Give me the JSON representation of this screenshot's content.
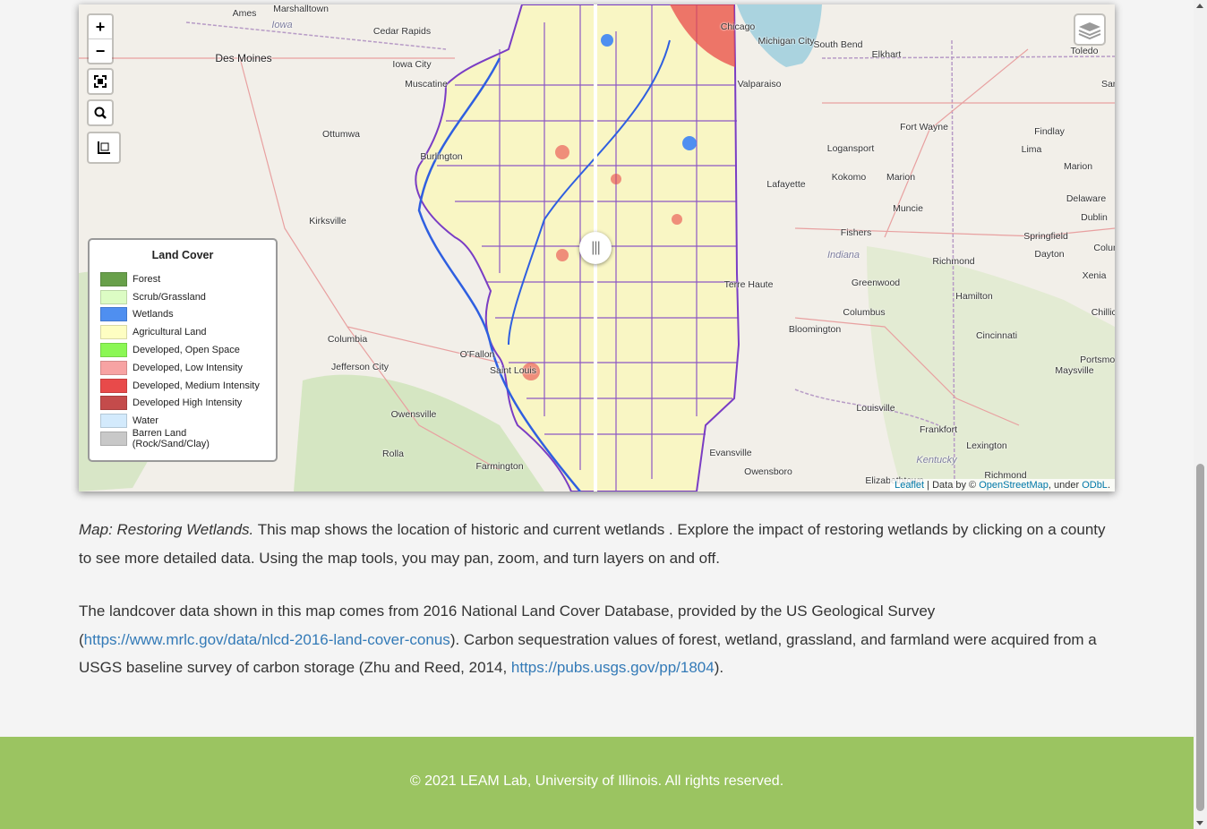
{
  "map": {
    "zoom_in_label": "+",
    "zoom_out_label": "−",
    "places": [
      "Ames",
      "Marshalltown",
      "Iowa",
      "Cedar Rapids",
      "Des Moines",
      "Iowa City",
      "Muscatine",
      "Ottumwa",
      "Kirksville",
      "Burlington",
      "Columbia",
      "Jefferson City",
      "Owensville",
      "Rolla",
      "Farmington",
      "O'Fallon",
      "Saint Louis",
      "Chicago",
      "Michigan City",
      "South Bend",
      "Elkhart",
      "Toledo",
      "Valparaiso",
      "Fort Wayne",
      "Findlay",
      "Lima",
      "Marion",
      "Logansport",
      "Kokomo",
      "Lafayette",
      "Marion",
      "Muncie",
      "Indiana",
      "Fishers",
      "Richmond",
      "Dayton",
      "Springfield",
      "Columbus",
      "Greenwood",
      "Terre Haute",
      "Bloomington",
      "Columbus",
      "Hamilton",
      "Cincinnati",
      "Chillicothe",
      "Xenia",
      "Dublin",
      "Delaware",
      "Louisville",
      "Frankfort",
      "Lexington",
      "Maysville",
      "Portsmouth",
      "Kentucky",
      "Evansville",
      "Owensboro",
      "Richmond",
      "Elizabethtown",
      "Sandusky"
    ],
    "legend": {
      "title": "Land Cover",
      "items": [
        {
          "label": "Forest",
          "color": "#68a04a"
        },
        {
          "label": "Scrub/Grassland",
          "color": "#dcfcc4"
        },
        {
          "label": "Wetlands",
          "color": "#4f8ff0"
        },
        {
          "label": "Agricultural Land",
          "color": "#fefec2"
        },
        {
          "label": "Developed, Open Space",
          "color": "#8bf754"
        },
        {
          "label": "Developed, Low Intensity",
          "color": "#f7a3a3"
        },
        {
          "label": "Developed, Medium Intensity",
          "color": "#e84a4a"
        },
        {
          "label": "Developed High Intensity",
          "color": "#c44b4b"
        },
        {
          "label": "Water",
          "color": "#d3eafc"
        },
        {
          "label": "Barren Land (Rock/Sand/Clay)",
          "color": "#c8c8c8"
        }
      ]
    },
    "attribution": {
      "leaflet": "Leaflet",
      "sep": " | Data by © ",
      "osm": "OpenStreetMap",
      "under": ", under ",
      "odbl": "ODbL",
      "end": "."
    }
  },
  "caption": {
    "title": "Map: Restoring Wetlands.",
    "text": " This map shows the location of historic and current wetlands . Explore the impact of restoring wetlands by clicking on a county to see more detailed data. Using the map tools, you may pan, zoom, and turn layers on and off."
  },
  "source": {
    "text1": "The landcover data shown in this map comes from 2016 National Land Cover Database, provided by the US Geological Survey (",
    "link1": "https://www.mrlc.gov/data/nlcd-2016-land-cover-conus",
    "text2": "). Carbon sequestration values of forest, wetland, grassland, and farmland were acquired from a USGS baseline survey of carbon storage (Zhu and Reed, 2014, ",
    "link2": "https://pubs.usgs.gov/pp/1804",
    "text3": ")."
  },
  "footer": {
    "text": "© 2021 LEAM Lab, University of Illinois. All rights reserved."
  }
}
